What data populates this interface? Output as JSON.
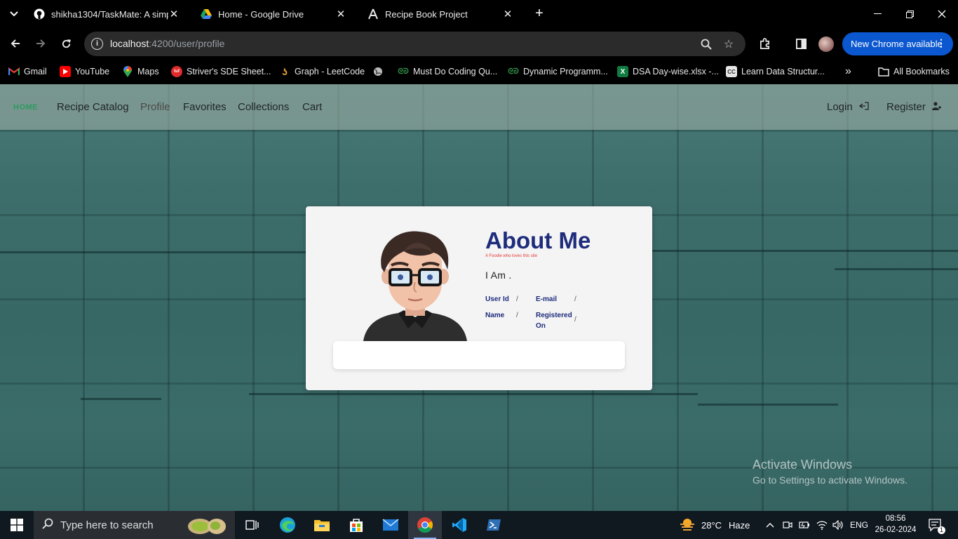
{
  "browser": {
    "tabs": [
      {
        "title": "shikha1304/TaskMate: A simple",
        "icon": "github-icon"
      },
      {
        "title": "Home - Google Drive",
        "icon": "google-drive-icon"
      },
      {
        "title": "Recipe Book Project",
        "icon": "angular-icon"
      }
    ],
    "url_host": "localhost",
    "url_path": ":4200/user/profile",
    "update_label": "New Chrome available",
    "bookmarks": [
      {
        "label": "Gmail"
      },
      {
        "label": "YouTube"
      },
      {
        "label": "Maps"
      },
      {
        "label": "Striver's SDE Sheet..."
      },
      {
        "label": "Graph - LeetCode"
      },
      {
        "label": ""
      },
      {
        "label": "Must Do Coding Qu..."
      },
      {
        "label": "Dynamic Programm..."
      },
      {
        "label": "DSA Day-wise.xlsx -..."
      },
      {
        "label": "Learn Data Structur..."
      }
    ],
    "all_bookmarks_label": "All Bookmarks"
  },
  "site": {
    "nav": {
      "home": "HOME",
      "recipe_catalog": "Recipe Catalog",
      "profile": "Profile",
      "favorites": "Favorites",
      "collections": "Collections",
      "cart": "Cart",
      "login": "Login",
      "register": "Register"
    },
    "profile_card": {
      "heading": "About Me",
      "tagline": "A Foodie who loves this site",
      "i_am": "I Am .",
      "user_id_label": "User Id",
      "email_label": "E-mail",
      "name_label": "Name",
      "registered_on_label_1": "Registered",
      "registered_on_label_2": "On",
      "separator": "/"
    }
  },
  "watermark": {
    "line1": "Activate Windows",
    "line2": "Go to Settings to activate Windows."
  },
  "taskbar": {
    "search_placeholder": "Type here to search",
    "weather_temp": "28°C",
    "weather_desc": "Haze",
    "language": "ENG",
    "time": "08:56",
    "date": "26-02-2024",
    "notification_count": "1"
  }
}
